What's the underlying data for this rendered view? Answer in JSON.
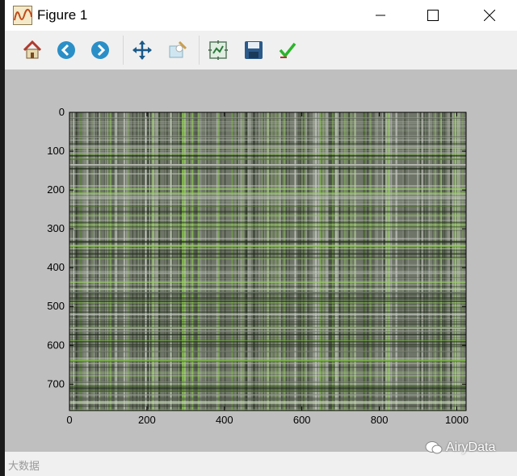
{
  "window": {
    "title": "Figure 1"
  },
  "toolbar": {
    "buttons": [
      {
        "name": "home",
        "icon": "home-icon"
      },
      {
        "name": "back",
        "icon": "back-arrow-icon"
      },
      {
        "name": "forward",
        "icon": "forward-arrow-icon"
      },
      {
        "name": "pan",
        "icon": "pan-move-icon"
      },
      {
        "name": "zoom",
        "icon": "zoom-rect-icon"
      },
      {
        "name": "subplots",
        "icon": "configure-subplots-icon"
      },
      {
        "name": "save",
        "icon": "save-disk-icon"
      },
      {
        "name": "edit",
        "icon": "edit-check-icon"
      }
    ]
  },
  "chart_data": {
    "type": "heatmap",
    "title": "",
    "xlabel": "",
    "ylabel": "",
    "xlim": [
      0,
      1024
    ],
    "ylim": [
      768,
      0
    ],
    "x_ticks": [
      "0",
      "200",
      "400",
      "600",
      "800",
      "1000"
    ],
    "y_ticks": [
      "0",
      "100",
      "200",
      "300",
      "400",
      "500",
      "600",
      "700"
    ],
    "x_tick_values": [
      0,
      200,
      400,
      600,
      800,
      1000
    ],
    "y_tick_values": [
      0,
      100,
      200,
      300,
      400,
      500,
      600,
      700
    ],
    "colors": {
      "dark": "#1f2a1a",
      "mid": "#6f7568",
      "light": "#c8ccc4",
      "accent": "#8fd14f"
    }
  },
  "status": {
    "watermark": "大数据",
    "brand": "AiryData"
  }
}
